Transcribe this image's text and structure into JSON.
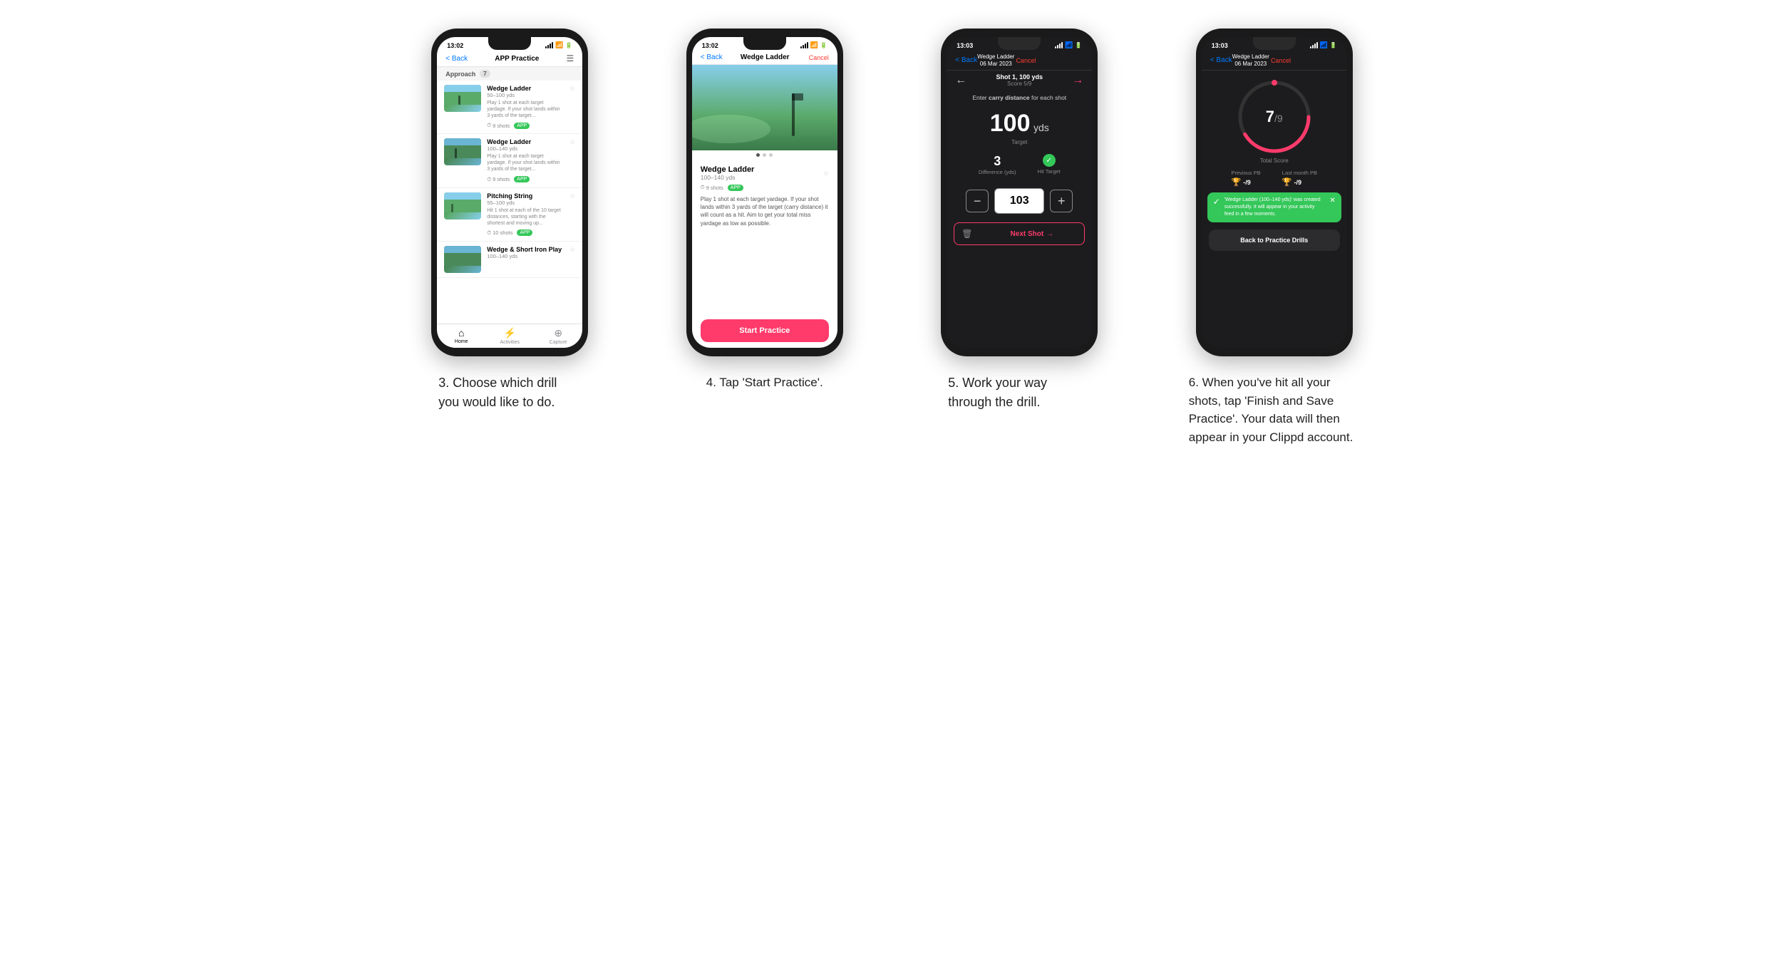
{
  "page": {
    "background": "#ffffff"
  },
  "phones": [
    {
      "id": "phone3",
      "caption": "3. Choose which drill you would like to do.",
      "statusBar": {
        "time": "13:02",
        "dark": false
      },
      "navBar": {
        "back": "< Back",
        "title": "APP Practice",
        "right": "☰"
      },
      "sectionHeader": "Approach",
      "sectionBadge": "7",
      "drills": [
        {
          "title": "Wedge Ladder",
          "range": "50–100 yds",
          "desc": "Play 1 shot at each target yardage. If your shot lands within 3 yards of the target...",
          "shots": "9 shots",
          "badge": "APP",
          "starred": false
        },
        {
          "title": "Wedge Ladder",
          "range": "100–140 yds",
          "desc": "Play 1 shot at each target yardage. If your shot lands within 3 yards of the target...",
          "shots": "9 shots",
          "badge": "APP",
          "starred": false
        },
        {
          "title": "Pitching String",
          "range": "55–100 yds",
          "desc": "Hit 1 shot at each of the 10 target distances, starting with the shortest and moving up...",
          "shots": "10 shots",
          "badge": "APP",
          "starred": false
        },
        {
          "title": "Wedge & Short Iron Play",
          "range": "100–140 yds",
          "desc": "",
          "shots": "",
          "badge": "",
          "starred": false
        }
      ],
      "tabs": [
        {
          "label": "Home",
          "icon": "⌂",
          "active": true
        },
        {
          "label": "Activities",
          "icon": "⚡",
          "active": false
        },
        {
          "label": "Capture",
          "icon": "⊕",
          "active": false
        }
      ]
    },
    {
      "id": "phone4",
      "caption": "4. Tap 'Start Practice'.",
      "statusBar": {
        "time": "13:02",
        "dark": false
      },
      "navBar": {
        "back": "< Back",
        "title": "Wedge Ladder",
        "cancel": "Cancel"
      },
      "drill": {
        "title": "Wedge Ladder",
        "range": "100–140 yds",
        "shots": "9 shots",
        "badge": "APP",
        "desc": "Play 1 shot at each target yardage. If your shot lands within 3 yards of the target (carry distance) it will count as a hit. Aim to get your total miss yardage as low as possible.",
        "starred": false
      },
      "startButton": "Start Practice"
    },
    {
      "id": "phone5",
      "caption": "5. Work your way through the drill.",
      "statusBar": {
        "time": "13:03",
        "dark": true
      },
      "navBar": {
        "back": "< Back",
        "titleLine1": "Wedge Ladder",
        "titleLine2": "06 Mar 2023",
        "cancel": "Cancel"
      },
      "shotNav": {
        "prevArrow": "←",
        "nextArrow": "→",
        "label": "Shot 1, 100 yds",
        "score": "Score 5/9"
      },
      "carryLabel": "Enter carry distance for each shot",
      "targetYds": "100",
      "targetUnit": "yds",
      "targetWord": "Target",
      "stats": [
        {
          "val": "3",
          "label": "Difference (yds)"
        },
        {
          "val": "✓",
          "label": "Hit Target",
          "isHit": true
        }
      ],
      "inputValue": "103",
      "nextShotLabel": "Next Shot",
      "nextArrow": "→"
    },
    {
      "id": "phone6",
      "caption": "6. When you've hit all your shots, tap 'Finish and Save Practice'. Your data will then appear in your Clippd account.",
      "statusBar": {
        "time": "13:03",
        "dark": true
      },
      "navBar": {
        "back": "< Back",
        "titleLine1": "Wedge Ladder",
        "titleLine2": "06 Mar 2023",
        "cancel": "Cancel"
      },
      "score": {
        "num": "7",
        "denom": "/9",
        "label": "Total Score"
      },
      "pb": {
        "previous": {
          "label": "Previous PB",
          "val": "-/9"
        },
        "lastMonth": {
          "label": "Last month PB",
          "val": "-/9"
        }
      },
      "successBanner": {
        "text": "'Wedge Ladder (100–140 yds)' was created successfully. It will appear in your activity feed in a few moments."
      },
      "backButton": "Back to Practice Drills"
    }
  ]
}
